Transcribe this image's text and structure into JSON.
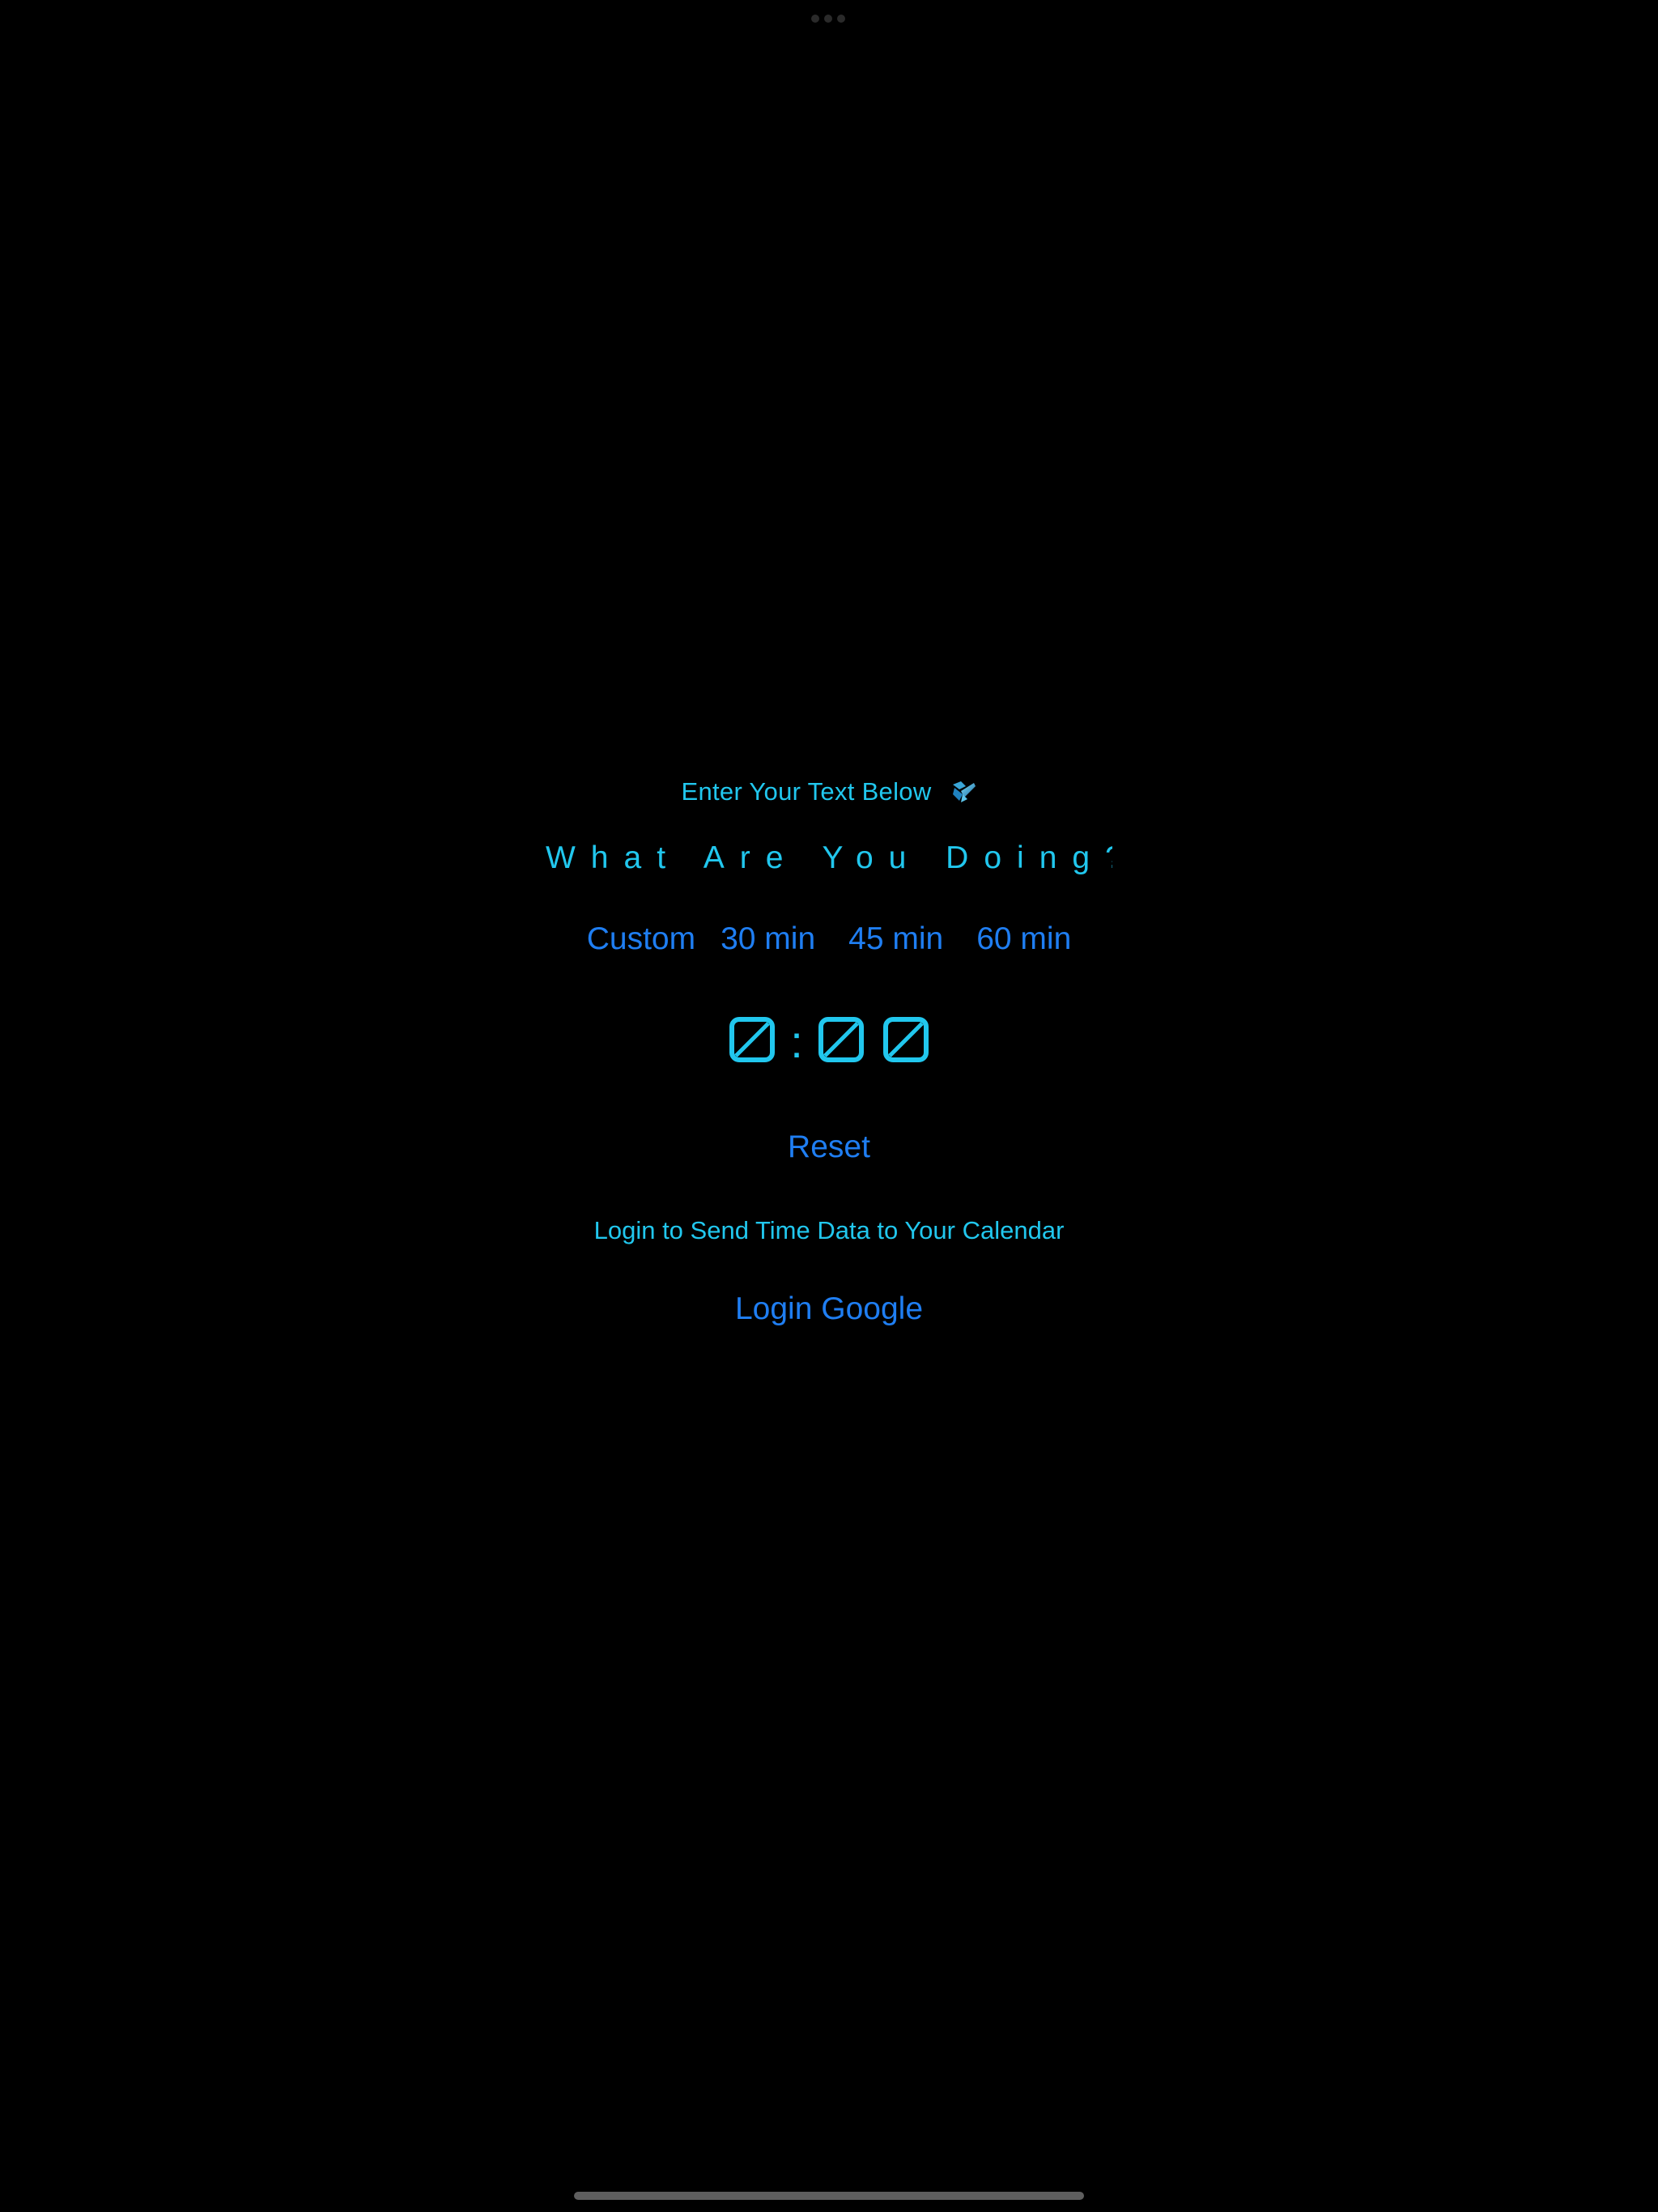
{
  "status_bar": {
    "multitask_indicator_icon": "ellipsis-dots"
  },
  "main": {
    "prompt_label": "Enter Your Text Below",
    "prompt_icon": "pencil-icon",
    "activity_input": {
      "placeholder": "What Are You Doing?",
      "value": ""
    },
    "presets": [
      {
        "label": "Custom"
      },
      {
        "label": "30 min"
      },
      {
        "label": "45 min"
      },
      {
        "label": "60 min"
      }
    ],
    "timer": {
      "digits": [
        "0",
        "0",
        "0"
      ],
      "separator": ":"
    },
    "reset_label": "Reset",
    "login_info": "Login to Send Time Data to Your Calendar",
    "login_label": "Login Google"
  },
  "colors": {
    "background": "#000000",
    "accent_cyan": "#21c7ee",
    "link_blue": "#1f7ef2",
    "home_indicator": "#5e5e5e"
  }
}
